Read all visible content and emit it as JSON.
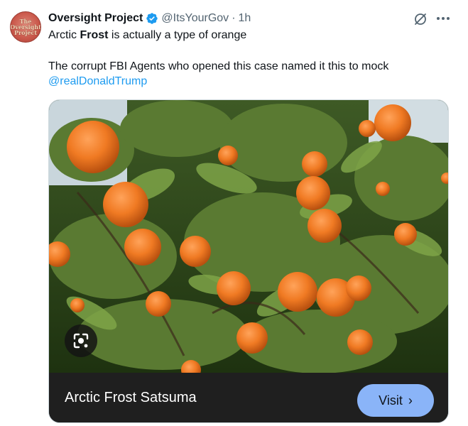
{
  "tweet": {
    "author": {
      "name": "Oversight Project",
      "handle": "@ItsYourGov",
      "separator": "·",
      "time": "1h",
      "avatar_text": [
        "The",
        "Oversight",
        "Project"
      ]
    },
    "line1_prefix": "Arctic ",
    "line1_bold": "Frost",
    "line1_suffix": " is actually a type of orange",
    "line2": "The corrupt FBI Agents who opened this case named it this to mock",
    "mention": "@realDonaldTrump"
  },
  "card": {
    "title": "Arctic Frost Satsuma",
    "button_label": "Visit",
    "button_chevron": "›"
  },
  "colors": {
    "verified": "#1d9bf0",
    "link": "#1d9bf0",
    "button": "#8ab4f8",
    "card_bar": "#1f1f1f"
  },
  "icons": [
    "verified-badge-icon",
    "grok-icon",
    "more-icon",
    "google-lens-icon",
    "chevron-right-icon"
  ]
}
